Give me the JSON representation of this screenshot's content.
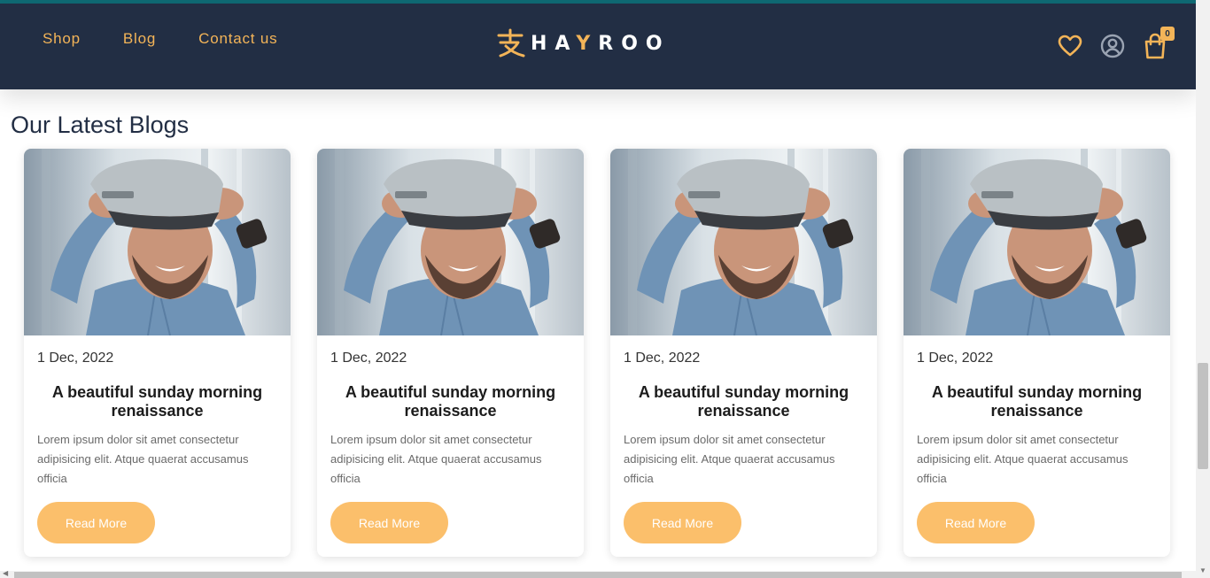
{
  "header": {
    "nav": [
      {
        "label": "Shop"
      },
      {
        "label": "Blog"
      },
      {
        "label": "Contact us"
      }
    ],
    "logo": {
      "prefix": "HA",
      "accent": "Y",
      "suffix": "ROO"
    },
    "icons": [
      "heart-icon",
      "user-icon",
      "shopping-bag-icon"
    ],
    "cart_count": "0"
  },
  "section": {
    "title": "Our Latest Blogs"
  },
  "posts": [
    {
      "date": "1 Dec, 2022",
      "title": "A beautiful sunday morning renaissance",
      "excerpt": "Lorem ipsum dolor sit amet consectetur adipisicing elit. Atque quaerat accusamus officia",
      "button": "Read More"
    },
    {
      "date": "1 Dec, 2022",
      "title": "A beautiful sunday morning renaissance",
      "excerpt": "Lorem ipsum dolor sit amet consectetur adipisicing elit. Atque quaerat accusamus officia",
      "button": "Read More"
    },
    {
      "date": "1 Dec, 2022",
      "title": "A beautiful sunday morning renaissance",
      "excerpt": "Lorem ipsum dolor sit amet consectetur adipisicing elit. Atque quaerat accusamus officia",
      "button": "Read More"
    },
    {
      "date": "1 Dec, 2022",
      "title": "A beautiful sunday morning renaissance",
      "excerpt": "Lorem ipsum dolor sit amet consectetur adipisicing elit. Atque quaerat accusamus officia",
      "button": "Read More"
    }
  ],
  "colors": {
    "header_bg": "#222e44",
    "accent": "#f3b458",
    "button": "#fbbf6b"
  }
}
